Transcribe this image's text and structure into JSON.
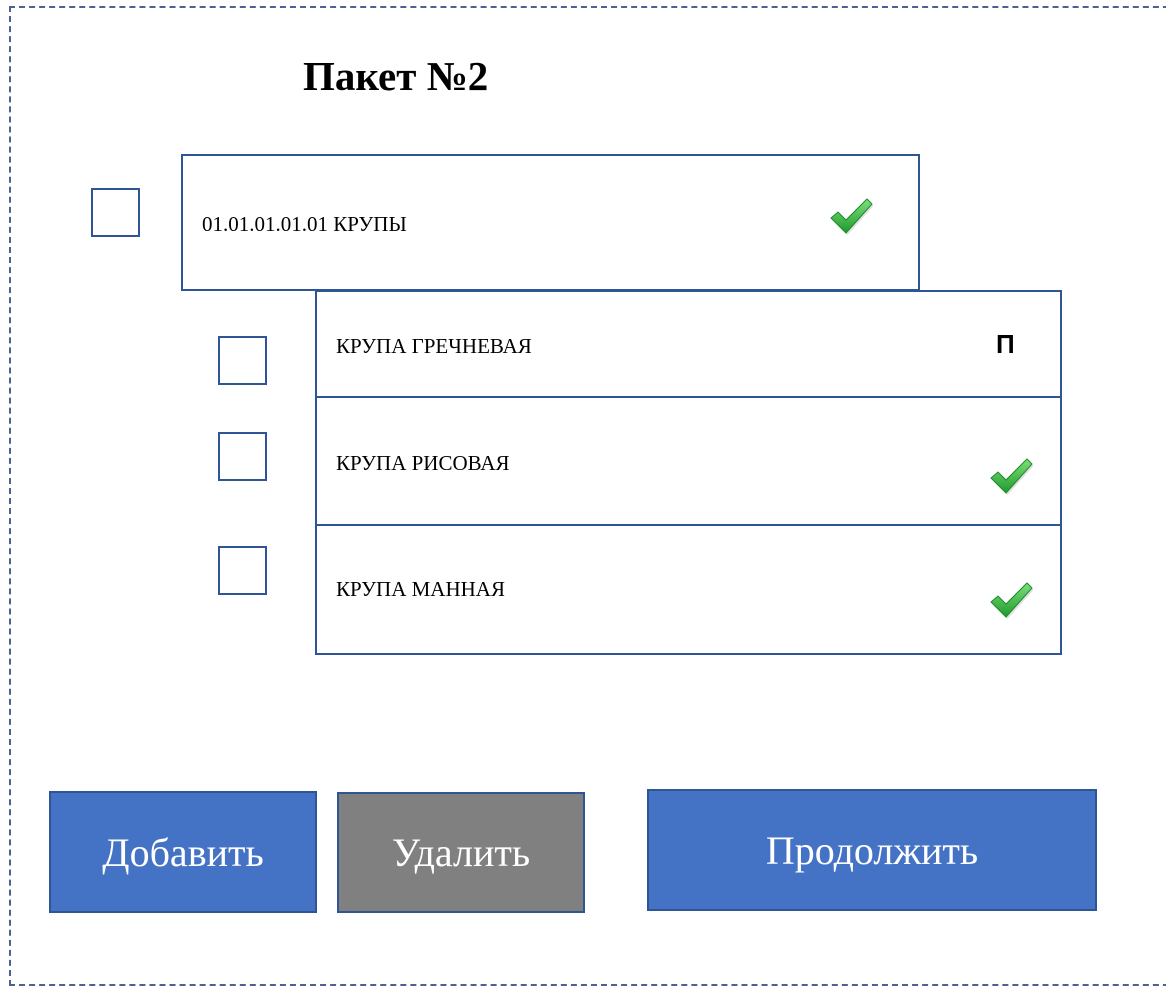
{
  "title": "Пакет №2",
  "category": {
    "label": "01.01.01.01.01 КРУПЫ",
    "status_icon": "check-icon",
    "checked": false
  },
  "items": [
    {
      "label": "КРУПА ГРЕЧНЕВАЯ",
      "status": "П",
      "status_icon": null,
      "checked": false
    },
    {
      "label": "КРУПА РИСОВАЯ",
      "status": null,
      "status_icon": "check-icon",
      "checked": false
    },
    {
      "label": "КРУПА МАННАЯ",
      "status": null,
      "status_icon": "check-icon",
      "checked": false
    }
  ],
  "buttons": {
    "add": "Добавить",
    "delete": "Удалить",
    "continue": "Продолжить"
  },
  "colors": {
    "accent": "#4472c4",
    "border": "#2f5597",
    "disabled": "#808080",
    "check": "#3cb043"
  }
}
